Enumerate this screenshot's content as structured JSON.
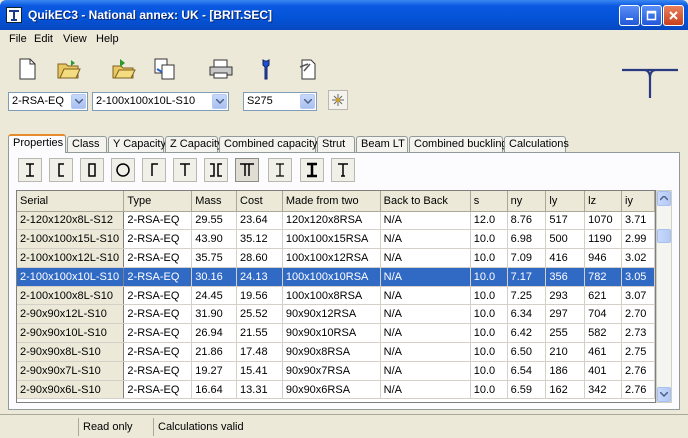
{
  "window": {
    "title": "QuikEC3 - National annex: UK - [BRIT.SEC]"
  },
  "menu": [
    "File",
    "Edit",
    "View",
    "Help"
  ],
  "toolbar": {
    "buttons": [
      "new-file",
      "open-folder",
      "import-folder",
      "copy-document",
      "print",
      "tools-wrench",
      "new-page-pin"
    ]
  },
  "selectors": {
    "type_value": "2-RSA-EQ",
    "section_value": "2-100x100x10L-S10",
    "grade_value": "S275"
  },
  "tabs": [
    "Properties",
    "Class",
    "Y Capacity",
    "Z Capacity",
    "Combined capacity",
    "Strut",
    "Beam LT",
    "Combined buckling",
    "Calculations"
  ],
  "active_tab": "Properties",
  "section_shapes": [
    "I-section",
    "channel",
    "rhs",
    "chs",
    "angle",
    "tee",
    "double-channel",
    "double-angle",
    "i-beam",
    "universal-beam",
    "universal-tee"
  ],
  "table": {
    "columns": [
      "Serial",
      "Type",
      "Mass",
      "Cost",
      "Made from two",
      "Back to Back",
      "s",
      "ny",
      "ly",
      "lz",
      "iy"
    ],
    "rows": [
      [
        "2-120x120x8L-S12",
        "2-RSA-EQ",
        "29.55",
        "23.64",
        "120x120x8RSA",
        "N/A",
        "12.0",
        "8.76",
        "517",
        "1070",
        "3.71"
      ],
      [
        "2-100x100x15L-S10",
        "2-RSA-EQ",
        "43.90",
        "35.12",
        "100x100x15RSA",
        "N/A",
        "10.0",
        "6.98",
        "500",
        "1190",
        "2.99"
      ],
      [
        "2-100x100x12L-S10",
        "2-RSA-EQ",
        "35.75",
        "28.60",
        "100x100x12RSA",
        "N/A",
        "10.0",
        "7.09",
        "416",
        "946",
        "3.02"
      ],
      [
        "2-100x100x10L-S10",
        "2-RSA-EQ",
        "30.16",
        "24.13",
        "100x100x10RSA",
        "N/A",
        "10.0",
        "7.17",
        "356",
        "782",
        "3.05"
      ],
      [
        "2-100x100x8L-S10",
        "2-RSA-EQ",
        "24.45",
        "19.56",
        "100x100x8RSA",
        "N/A",
        "10.0",
        "7.25",
        "293",
        "621",
        "3.07"
      ],
      [
        "2-90x90x12L-S10",
        "2-RSA-EQ",
        "31.90",
        "25.52",
        "90x90x12RSA",
        "N/A",
        "10.0",
        "6.34",
        "297",
        "704",
        "2.70"
      ],
      [
        "2-90x90x10L-S10",
        "2-RSA-EQ",
        "26.94",
        "21.55",
        "90x90x10RSA",
        "N/A",
        "10.0",
        "6.42",
        "255",
        "582",
        "2.73"
      ],
      [
        "2-90x90x8L-S10",
        "2-RSA-EQ",
        "21.86",
        "17.48",
        "90x90x8RSA",
        "N/A",
        "10.0",
        "6.50",
        "210",
        "461",
        "2.75"
      ],
      [
        "2-90x90x7L-S10",
        "2-RSA-EQ",
        "19.27",
        "15.41",
        "90x90x7RSA",
        "N/A",
        "10.0",
        "6.54",
        "186",
        "401",
        "2.76"
      ],
      [
        "2-90x90x6L-S10",
        "2-RSA-EQ",
        "16.64",
        "13.31",
        "90x90x6RSA",
        "N/A",
        "10.0",
        "6.59",
        "162",
        "342",
        "2.76"
      ]
    ],
    "selected_row": 3
  },
  "status": {
    "mode": "Read only",
    "calc": "Calculations valid"
  },
  "colors": {
    "title_blue": "#0454d8",
    "selection": "#316ac5",
    "tab_accent": "#e68b2c"
  }
}
